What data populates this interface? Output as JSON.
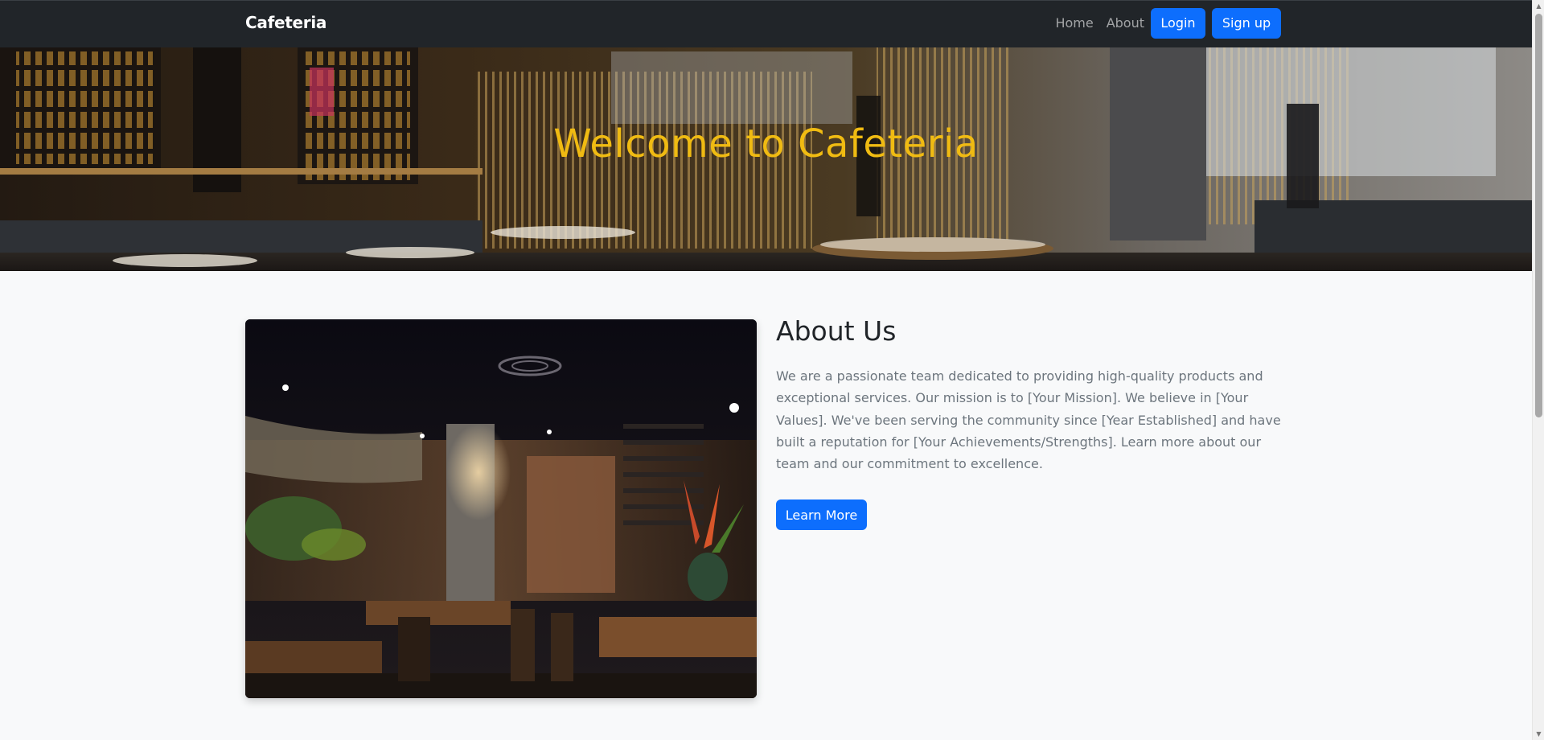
{
  "navbar": {
    "brand": "Cafeteria",
    "links": [
      "Home",
      "About"
    ],
    "login_label": "Login",
    "signup_label": "Sign up"
  },
  "hero": {
    "title": "Welcome to Cafeteria"
  },
  "about": {
    "heading": "About Us",
    "text": "We are a passionate team dedicated to providing high-quality products and exceptional services. Our mission is to [Your Mission]. We believe in [Your Values]. We've been serving the community since [Year Established] and have built a reputation for [Your Achievements/Strengths]. Learn more about our team and our commitment to excellence.",
    "button_label": "Learn More"
  },
  "colors": {
    "navbar_bg": "#212529",
    "primary": "#0d6efd",
    "hero_title": "#f0bb12",
    "page_bg": "#f8f9fa"
  }
}
